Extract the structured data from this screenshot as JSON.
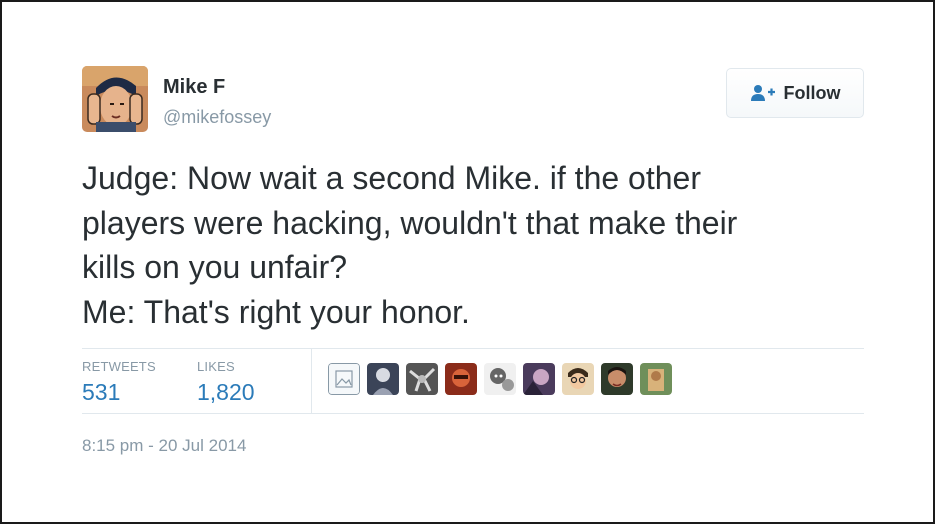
{
  "user": {
    "name": "Mike F",
    "handle": "@mikefossey"
  },
  "follow_button": {
    "label": "Follow"
  },
  "tweet": {
    "lines": [
      "Judge: Now wait a second Mike. if the other",
      "players were hacking, wouldn't that make their",
      "kills on you unfair?",
      "Me: That's right your honor."
    ]
  },
  "stats": {
    "retweets_label": "RETWEETS",
    "retweets_value": "531",
    "likes_label": "LIKES",
    "likes_value": "1,820"
  },
  "likers": [
    {
      "icon": "default-avatar-icon"
    },
    {
      "icon": "user-avatar-icon"
    },
    {
      "icon": "user-avatar-icon"
    },
    {
      "icon": "user-avatar-icon"
    },
    {
      "icon": "user-avatar-icon"
    },
    {
      "icon": "user-avatar-icon"
    },
    {
      "icon": "user-avatar-icon"
    },
    {
      "icon": "user-avatar-icon"
    },
    {
      "icon": "user-avatar-icon"
    }
  ],
  "timestamp": "8:15 pm - 20 Jul 2014",
  "colors": {
    "text": "#292f33",
    "muted": "#8899a6",
    "link": "#2b7bb9",
    "border": "#e1e8ed"
  }
}
